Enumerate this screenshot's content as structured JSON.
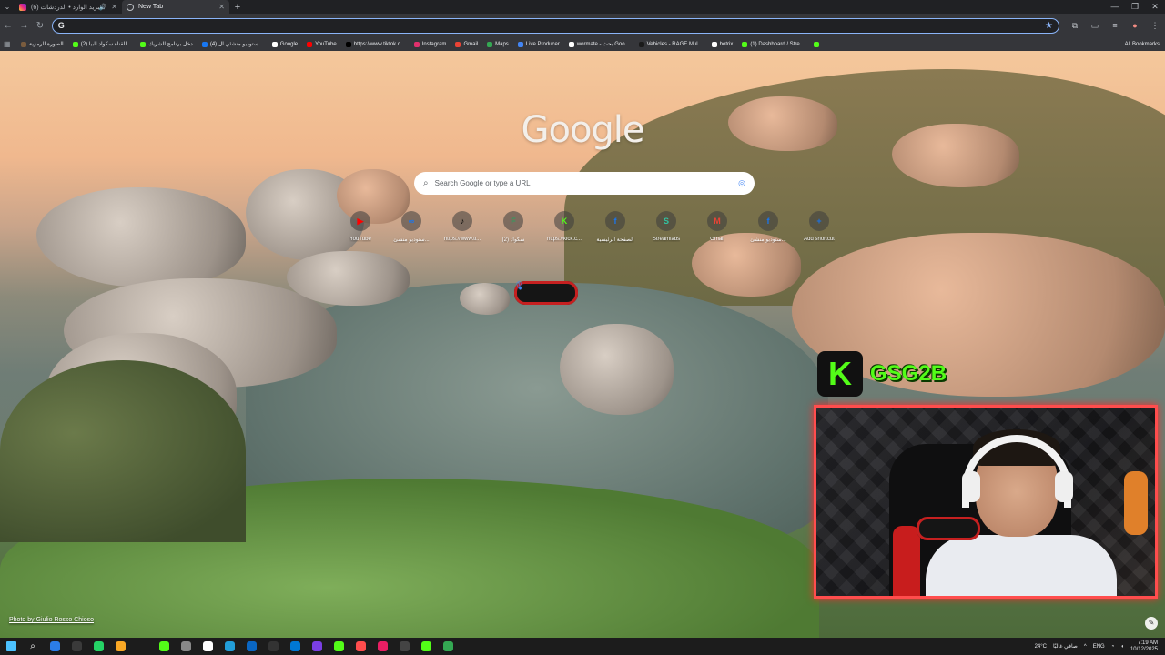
{
  "tabs": [
    {
      "title": "البريد الوارد • الدردشات (6)",
      "audio": "🔊",
      "active": false
    },
    {
      "title": "New Tab",
      "active": true
    }
  ],
  "omnibox": {
    "value": "",
    "placeholder": ""
  },
  "bookmarks": [
    "الصورة الرمزية",
    "(2) القناة سكواد البيا...",
    "دخل برنامج الشريك",
    "(4) ستوديو منشئي ال...",
    "Google",
    "YouTube",
    "https://www.tiktok.c...",
    "Instagram",
    "Gmail",
    "Maps",
    "Live Producer",
    "wormate - بحث Goo...",
    "Vehicles - RAGE Mul...",
    "botrix",
    "(1) Dashboard / Stre...",
    ""
  ],
  "all_bookmarks": "All Bookmarks",
  "ntp": {
    "logo": "Google",
    "search_placeholder": "Search Google or type a URL",
    "shortcuts": [
      {
        "label": "YouTube",
        "glyph": "▶",
        "color": "#ff0000"
      },
      {
        "label": "ستوديو منشئ...",
        "glyph": "∞",
        "color": "#1877f2"
      },
      {
        "label": "https://www.ti...",
        "glyph": "♪",
        "color": "#000000"
      },
      {
        "label": "(2) سكواد",
        "glyph": "F",
        "color": "#2e9d5d"
      },
      {
        "label": "https://kick.c...",
        "glyph": "K",
        "color": "#53fc18"
      },
      {
        "label": "الصفحة الرئيسية",
        "glyph": "f",
        "color": "#1877f2"
      },
      {
        "label": "Streamlabs",
        "glyph": "S",
        "color": "#31c3a2"
      },
      {
        "label": "Gmail",
        "glyph": "M",
        "color": "#ea4335"
      },
      {
        "label": "ستوديو منشئ...",
        "glyph": "f",
        "color": "#1877f2"
      },
      {
        "label": "Add shortcut",
        "glyph": "+",
        "color": "#1a73e8"
      }
    ],
    "photo_credit": "Photo by Giulio Rosso Chioso"
  },
  "overlay": {
    "logo_letter": "K",
    "channel": "GSG2B"
  },
  "taskbar": {
    "weather": "24°C",
    "weather_desc": "صافي غالبًا",
    "lang": "ENG",
    "time": "7:19 AM",
    "date": "10/12/2025"
  }
}
